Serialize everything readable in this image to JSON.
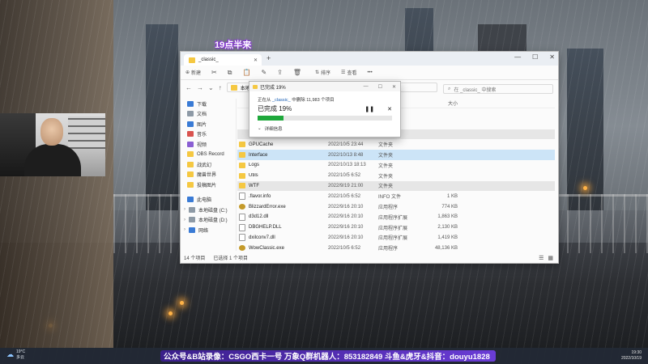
{
  "overlay": {
    "annotation": "19点半来"
  },
  "explorer": {
    "tab_title": "_classic_",
    "toolbar": {
      "new_label": "新建",
      "sort_label": "排序",
      "view_label": "查看",
      "more_label": "•••"
    },
    "address_prefix": "本地",
    "search_placeholder": "在 _classic_ 中搜索",
    "sidebar": [
      {
        "label": "下载",
        "icon": "download-icon"
      },
      {
        "label": "文档",
        "icon": "document-icon"
      },
      {
        "label": "图片",
        "icon": "picture-icon"
      },
      {
        "label": "音乐",
        "icon": "music-icon"
      },
      {
        "label": "视频",
        "icon": "video-icon"
      },
      {
        "label": "OBS Record",
        "icon": "folder-icon"
      },
      {
        "label": "战武幻",
        "icon": "folder-icon"
      },
      {
        "label": "魔兽世界",
        "icon": "folder-icon"
      },
      {
        "label": "投稿图片",
        "icon": "folder-icon"
      }
    ],
    "sidebar_bottom": [
      {
        "label": "此电脑",
        "icon": "computer-icon"
      },
      {
        "label": "本地磁盘 (C:)",
        "icon": "drive-icon"
      },
      {
        "label": "本地磁盘 (D:)",
        "icon": "drive-icon"
      },
      {
        "label": "网络",
        "icon": "network-icon"
      }
    ],
    "column_size": "大小",
    "files": [
      {
        "name": "GPUCache",
        "date": "2022/10/5 23:44",
        "type": "文件夹",
        "size": "",
        "kind": "folder"
      },
      {
        "name": "Interface",
        "date": "2022/10/13 8:48",
        "type": "文件夹",
        "size": "",
        "kind": "folder"
      },
      {
        "name": "Logs",
        "date": "2022/10/13 18:13",
        "type": "文件夹",
        "size": "",
        "kind": "folder"
      },
      {
        "name": "Utils",
        "date": "2022/10/5 6:52",
        "type": "文件夹",
        "size": "",
        "kind": "folder"
      },
      {
        "name": "WTF",
        "date": "2022/9/19 21:00",
        "type": "文件夹",
        "size": "",
        "kind": "folder"
      },
      {
        "name": ".flavor.info",
        "date": "2022/10/5 6:52",
        "type": "INFO 文件",
        "size": "1 KB",
        "kind": "file"
      },
      {
        "name": "BlizzardError.exe",
        "date": "2022/9/16 20:10",
        "type": "应用程序",
        "size": "774 KB",
        "kind": "exe"
      },
      {
        "name": "d3d12.dll",
        "date": "2022/9/16 20:10",
        "type": "应用程序扩展",
        "size": "1,863 KB",
        "kind": "file"
      },
      {
        "name": "DBGHELP.DLL",
        "date": "2022/9/16 20:10",
        "type": "应用程序扩展",
        "size": "2,130 KB",
        "kind": "file"
      },
      {
        "name": "dxilconv7.dll",
        "date": "2022/9/16 20:10",
        "type": "应用程序扩展",
        "size": "1,419 KB",
        "kind": "file"
      },
      {
        "name": "WowClassic.exe",
        "date": "2022/10/5 6:52",
        "type": "应用程序",
        "size": "48,136 KB",
        "kind": "exe"
      }
    ],
    "status_count": "14 个项目",
    "status_selected": "已选择 1 个项目"
  },
  "dialog": {
    "title": "已完成 19%",
    "message_prefix": "正在从",
    "message_link": "_classic_",
    "message_suffix": "中删除 11,983 个项目",
    "percent_text": "已完成 19%",
    "progress": 0.19,
    "details_label": "详细信息"
  },
  "taskbar": {
    "weather_temp": "19°C",
    "weather_desc": "多云",
    "ticker": "公众号&B站录像：CSGO西卡一号  万象Q群机器人：853182849  斗鱼&虎牙&抖音：douyu1828",
    "time": "19:30",
    "date": "2022/10/19"
  }
}
